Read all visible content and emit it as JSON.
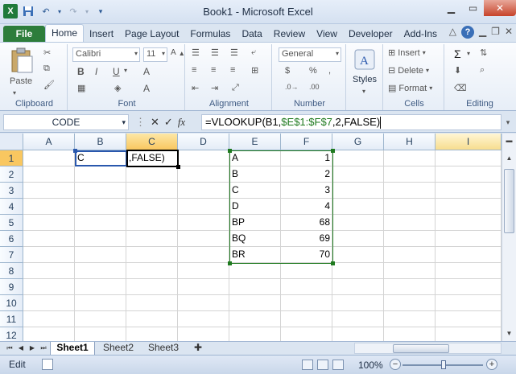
{
  "window": {
    "title": "Book1 - Microsoft Excel",
    "app_icon": "X"
  },
  "ribbon_tabs": [
    "File",
    "Home",
    "Insert",
    "Page Layout",
    "Formulas",
    "Data",
    "Review",
    "View",
    "Developer",
    "Add-Ins"
  ],
  "active_tab": "Home",
  "ribbon": {
    "clipboard": {
      "paste": "Paste",
      "label": "Clipboard"
    },
    "font": {
      "name": "Calibri",
      "size": "11",
      "label": "Font"
    },
    "alignment": {
      "label": "Alignment"
    },
    "number": {
      "format": "General",
      "label": "Number"
    },
    "styles": {
      "label": "Styles"
    },
    "cells": {
      "insert": "Insert",
      "delete": "Delete",
      "format": "Format",
      "label": "Cells"
    },
    "editing": {
      "label": "Editing"
    }
  },
  "formula_bar": {
    "name_box": "CODE",
    "formula_prefix": "=VLOOKUP(B1,",
    "formula_ref": "$E$1:$F$7",
    "formula_suffix": ",2,FALSE)"
  },
  "columns": [
    "A",
    "B",
    "C",
    "D",
    "E",
    "F",
    "G",
    "H",
    "I"
  ],
  "rows": [
    "1",
    "2",
    "3",
    "4",
    "5",
    "6",
    "7",
    "8",
    "9",
    "10",
    "11",
    "12"
  ],
  "cells": {
    "B1": "C",
    "C1": ",FALSE)",
    "E": [
      "A",
      "B",
      "C",
      "D",
      "BP",
      "BQ",
      "BR"
    ],
    "F": [
      "1",
      "2",
      "3",
      "4",
      "68",
      "69",
      "70"
    ]
  },
  "sheets": [
    "Sheet1",
    "Sheet2",
    "Sheet3"
  ],
  "active_sheet": "Sheet1",
  "status": {
    "mode": "Edit",
    "zoom": "100%"
  },
  "colors": {
    "file_tab": "#2d7d3b",
    "reference_range": "#1f7a1f",
    "selected_header": "#f9c760"
  }
}
